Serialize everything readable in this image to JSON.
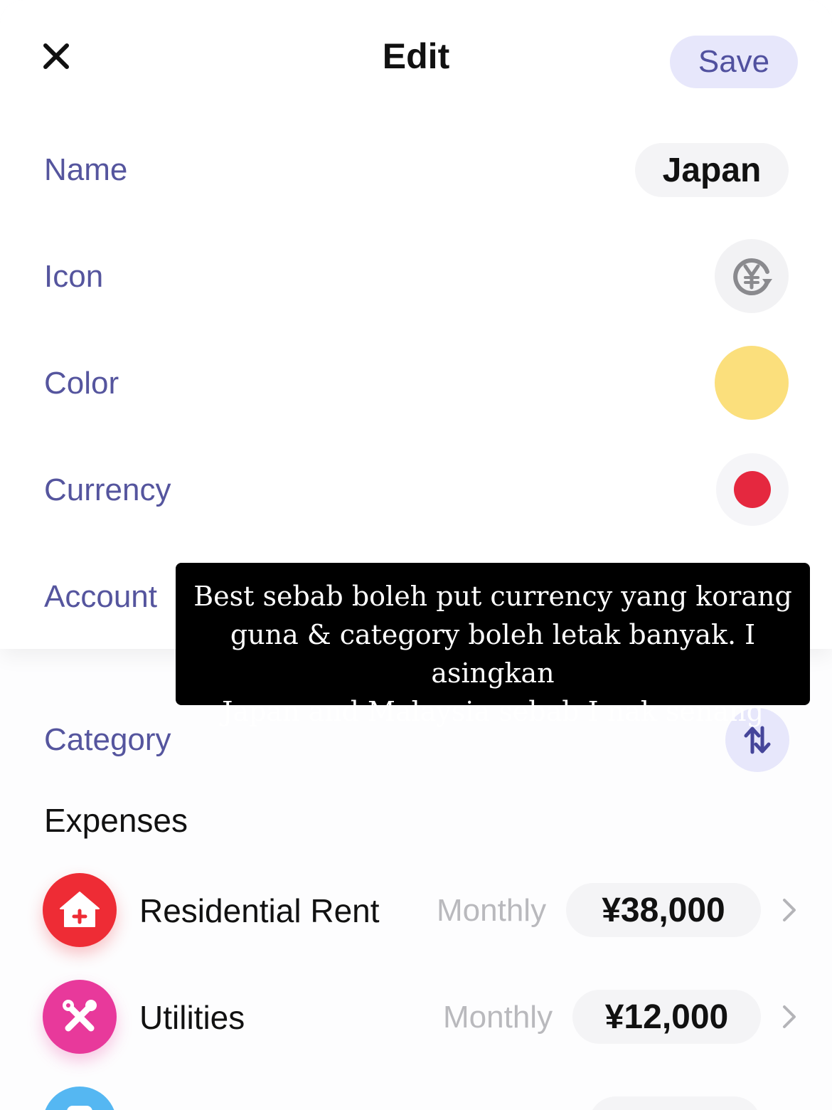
{
  "header": {
    "title": "Edit",
    "save_label": "Save",
    "close_icon": "close-icon"
  },
  "form": {
    "name_label": "Name",
    "name_value": "Japan",
    "icon_label": "Icon",
    "icon_value": "yen-exchange-icon",
    "color_label": "Color",
    "color_value": "#fbdf7c",
    "currency_label": "Currency",
    "currency_flag_color": "#e5283f",
    "account_label": "Account",
    "category_label": "Category"
  },
  "expenses": {
    "title": "Expenses",
    "items": [
      {
        "name": "Residential Rent",
        "period": "Monthly",
        "amount": "¥38,000",
        "icon": "house-plus-icon",
        "color": "#ee2c35"
      },
      {
        "name": "Utilities",
        "period": "Monthly",
        "amount": "¥12,000",
        "icon": "tools-icon",
        "color": "#e8399b"
      },
      {
        "icon": "partial-icon",
        "color": "#55b7f2"
      }
    ]
  },
  "caption": {
    "lines": [
      "Best sebab boleh put currency yang korang",
      "guna & category boleh letak banyak. I asingkan",
      "Japan and Malaysia sebab I nak senang"
    ]
  }
}
